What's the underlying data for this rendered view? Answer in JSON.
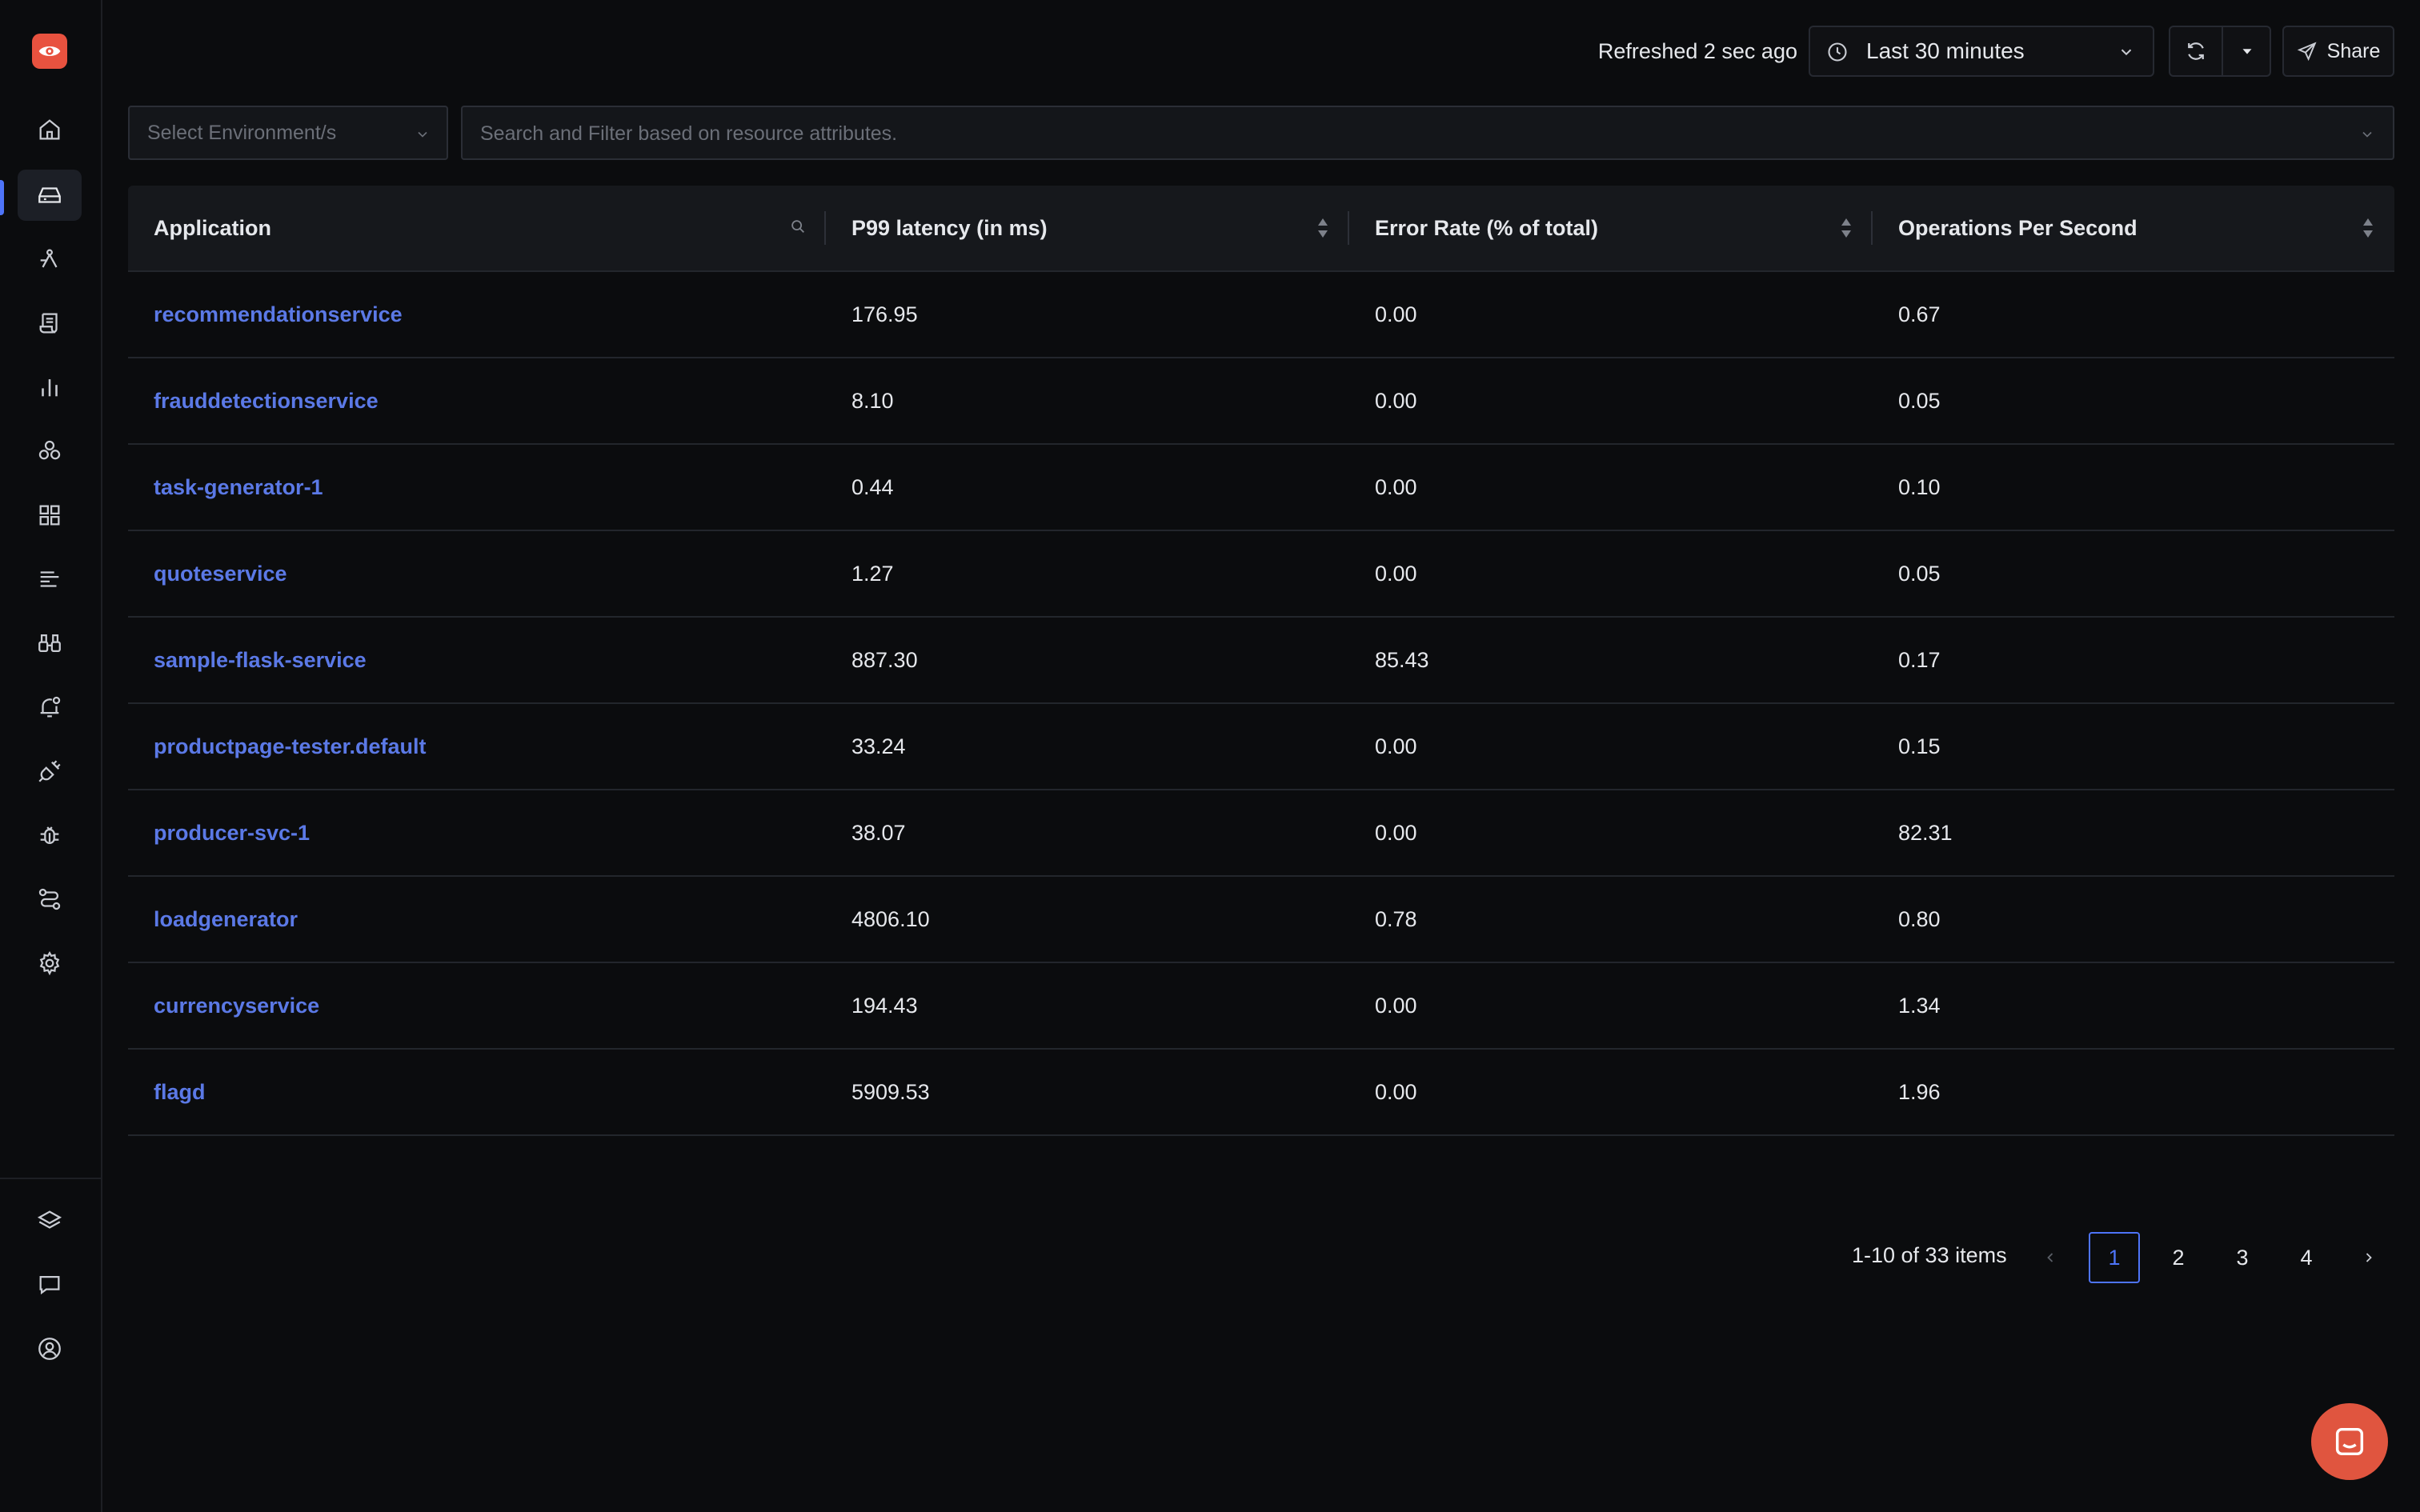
{
  "sidebar": {
    "top_items": [
      {
        "icon": "home-icon"
      },
      {
        "icon": "inbox-icon",
        "active": true
      },
      {
        "icon": "network-icon"
      },
      {
        "icon": "scroll-icon"
      },
      {
        "icon": "bar-chart-icon"
      },
      {
        "icon": "integrations-icon"
      },
      {
        "icon": "grid-icon"
      },
      {
        "icon": "list-icon"
      },
      {
        "icon": "binoculars-icon"
      },
      {
        "icon": "bell-icon"
      },
      {
        "icon": "plug-icon"
      },
      {
        "icon": "bug-icon"
      },
      {
        "icon": "route-icon"
      },
      {
        "icon": "gear-icon"
      }
    ],
    "bottom_items": [
      {
        "icon": "layers-icon"
      },
      {
        "icon": "message-icon"
      },
      {
        "icon": "user-icon"
      }
    ]
  },
  "header": {
    "refreshed": "Refreshed 2 sec ago",
    "time_range": "Last 30 minutes",
    "share_label": "Share"
  },
  "filters": {
    "environment_placeholder": "Select Environment/s",
    "search_placeholder": "Search and Filter based on resource attributes."
  },
  "table": {
    "columns": [
      "Application",
      "P99 latency (in ms)",
      "Error Rate (% of total)",
      "Operations Per Second"
    ],
    "rows": [
      {
        "app": "recommendationservice",
        "p99": "176.95",
        "error": "0.00",
        "ops": "0.67"
      },
      {
        "app": "frauddetectionservice",
        "p99": "8.10",
        "error": "0.00",
        "ops": "0.05"
      },
      {
        "app": "task-generator-1",
        "p99": "0.44",
        "error": "0.00",
        "ops": "0.10"
      },
      {
        "app": "quoteservice",
        "p99": "1.27",
        "error": "0.00",
        "ops": "0.05"
      },
      {
        "app": "sample-flask-service",
        "p99": "887.30",
        "error": "85.43",
        "ops": "0.17"
      },
      {
        "app": "productpage-tester.default",
        "p99": "33.24",
        "error": "0.00",
        "ops": "0.15"
      },
      {
        "app": "producer-svc-1",
        "p99": "38.07",
        "error": "0.00",
        "ops": "82.31"
      },
      {
        "app": "loadgenerator",
        "p99": "4806.10",
        "error": "0.78",
        "ops": "0.80"
      },
      {
        "app": "currencyservice",
        "p99": "194.43",
        "error": "0.00",
        "ops": "1.34"
      },
      {
        "app": "flagd",
        "p99": "5909.53",
        "error": "0.00",
        "ops": "1.96"
      }
    ]
  },
  "pagination": {
    "summary": "1-10 of 33 items",
    "pages": [
      "1",
      "2",
      "3",
      "4"
    ],
    "current": "1"
  },
  "colors": {
    "accent": "#4e74f8",
    "link": "#5b79e6",
    "brand": "#e8523f"
  }
}
